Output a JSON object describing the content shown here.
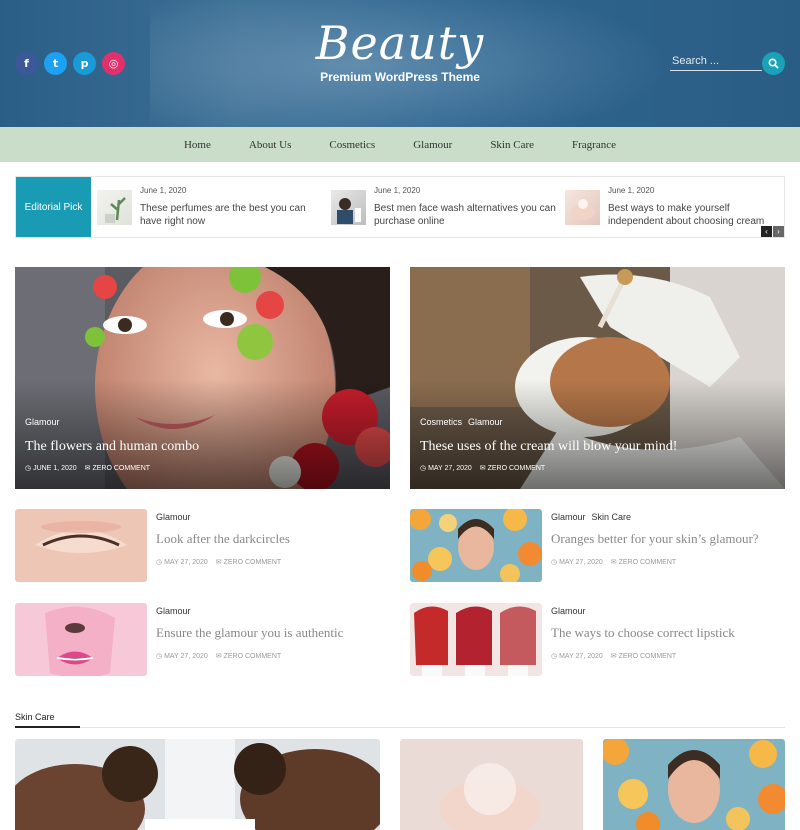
{
  "header": {
    "logo_script": "Beauty",
    "logo_tagline": "Premium WordPress Theme",
    "search_placeholder": "Search ...",
    "socials": [
      {
        "name": "facebook",
        "glyph": "f",
        "color": "#3b5998"
      },
      {
        "name": "twitter",
        "glyph": "t",
        "color": "#1da1f2"
      },
      {
        "name": "pinterest",
        "glyph": "p",
        "color": "#1a9ad8"
      },
      {
        "name": "instagram",
        "glyph": "◎",
        "color": "#e1306c"
      }
    ],
    "header_color": "#2b5e86",
    "accent": "#19a2b8"
  },
  "nav": {
    "items": [
      "Home",
      "About Us",
      "Cosmetics",
      "Glamour",
      "Skin Care",
      "Fragrance"
    ],
    "bg_color": "#c9ddc8"
  },
  "ticker": {
    "label": "Editorial Pick",
    "items": [
      {
        "date": "June 1, 2020",
        "title": "These perfumes are the best you can have right now"
      },
      {
        "date": "June 1, 2020",
        "title": "Best men face wash alternatives you can purchase online"
      },
      {
        "date": "June 1, 2020",
        "title": "Best ways to make yourself independent about choosing cream"
      }
    ],
    "prev_glyph": "‹",
    "next_glyph": "›"
  },
  "featured": [
    {
      "cats": [
        "Glamour"
      ],
      "title": "The flowers and human combo",
      "date": "JUNE 1, 2020",
      "comments": "ZERO COMMENT"
    },
    {
      "cats": [
        "Cosmetics",
        "Glamour"
      ],
      "title": "These uses of the cream will blow your mind!",
      "date": "MAY 27, 2020",
      "comments": "ZERO COMMENT"
    }
  ],
  "posts": [
    {
      "cats": [
        "Glamour"
      ],
      "title": "Look after the darkcircles",
      "date": "MAY 27, 2020",
      "comments": "ZERO COMMENT"
    },
    {
      "cats": [
        "Glamour",
        "Skin Care"
      ],
      "title": "Oranges better for your skin’s glamour?",
      "date": "MAY 27, 2020",
      "comments": "ZERO COMMENT"
    },
    {
      "cats": [
        "Glamour"
      ],
      "title": "Ensure the glamour you is authentic",
      "date": "MAY 27, 2020",
      "comments": "ZERO COMMENT"
    },
    {
      "cats": [
        "Glamour"
      ],
      "title": "The ways to choose correct lipstick",
      "date": "MAY 27, 2020",
      "comments": "ZERO COMMENT"
    }
  ],
  "section": {
    "title": "Skin Care"
  }
}
